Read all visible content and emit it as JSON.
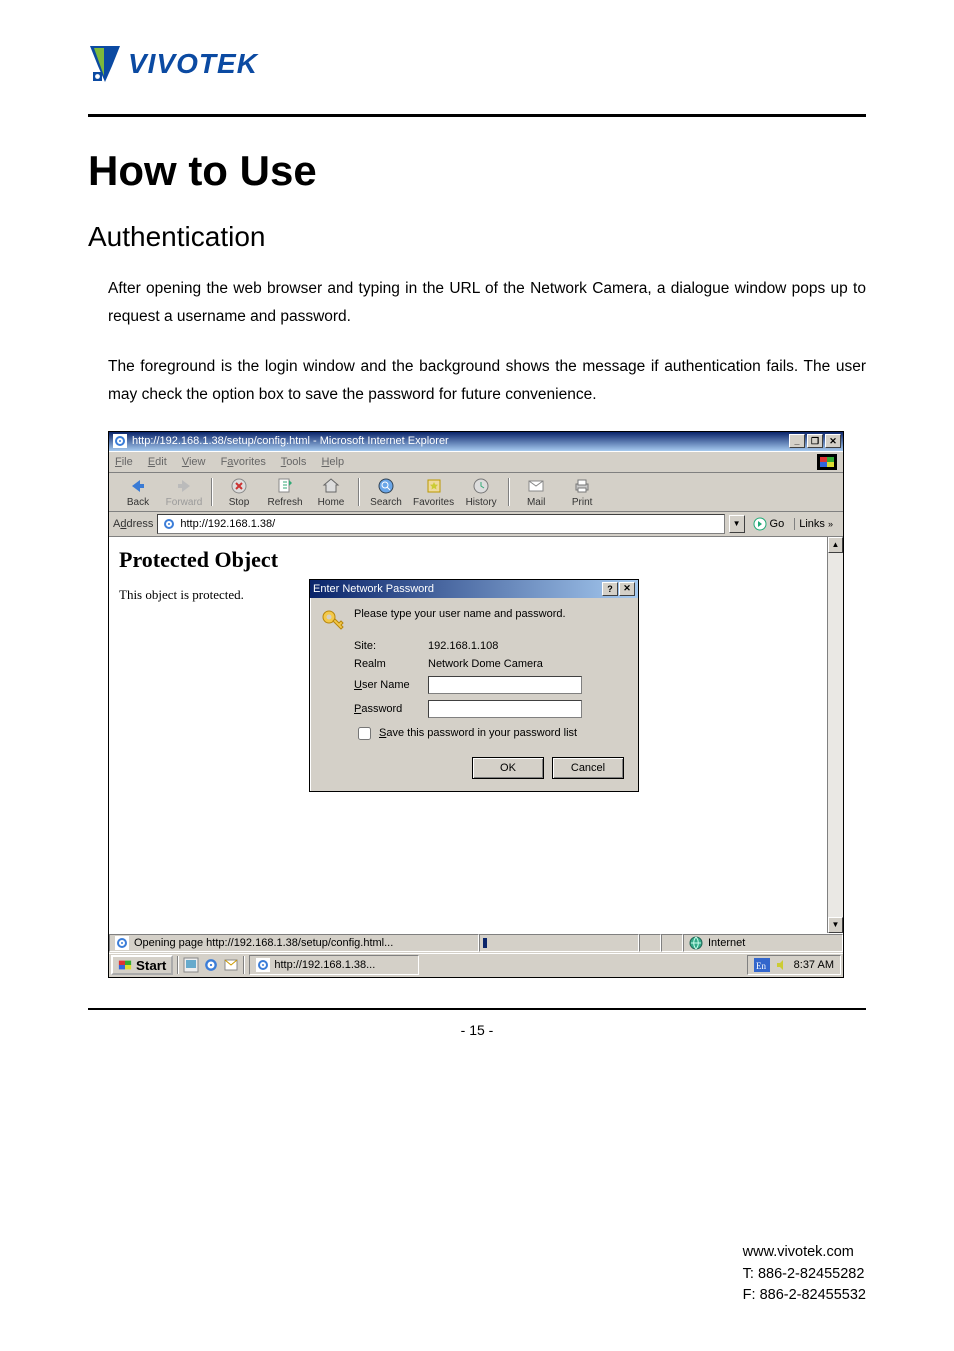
{
  "logo": {
    "text": "VIVOTEK"
  },
  "headings": {
    "h1": "How to Use",
    "h2": "Authentication"
  },
  "paragraphs": {
    "p1": "After opening the web browser and typing in the URL of the Network Camera, a dialogue window pops up to request a username and password.",
    "p2": "The foreground is the login window and the background shows the message if authentication fails. The user may check the option box to save the password for future convenience."
  },
  "browser": {
    "title": "http://192.168.1.38/setup/config.html - Microsoft Internet Explorer",
    "menu": {
      "file": "File",
      "edit": "Edit",
      "view": "View",
      "fav": "Favorites",
      "tools": "Tools",
      "help": "Help"
    },
    "toolbar": {
      "back": "Back",
      "forward": "Forward",
      "stop": "Stop",
      "refresh": "Refresh",
      "home": "Home",
      "search": "Search",
      "favorites": "Favorites",
      "history": "History",
      "mail": "Mail",
      "print": "Print"
    },
    "address": {
      "label": "Address",
      "value": "http://192.168.1.38/",
      "go": "Go",
      "links": "Links"
    },
    "page": {
      "heading": "Protected Object",
      "note": "This object is protected."
    },
    "status": {
      "opening": "Opening page http://192.168.1.38/setup/config.html...",
      "zone": "Internet"
    }
  },
  "dialog": {
    "title": "Enter Network Password",
    "instruction": "Please type your user name and password.",
    "site_label": "Site:",
    "site_value": "192.168.1.108",
    "realm_label": "Realm",
    "realm_value": "Network Dome Camera",
    "user_label": "User Name",
    "user_value": "",
    "pass_label": "Password",
    "pass_value": "",
    "save_label": "Save this password in your password list",
    "ok": "OK",
    "cancel": "Cancel"
  },
  "taskbar": {
    "start": "Start",
    "task": "http://192.168.1.38...",
    "time": "8:37 AM"
  },
  "footer": {
    "page": "- 15 -",
    "site": "www.vivotek.com",
    "tel": "T: 886-2-82455282",
    "fax": "F: 886-2-82455532"
  }
}
